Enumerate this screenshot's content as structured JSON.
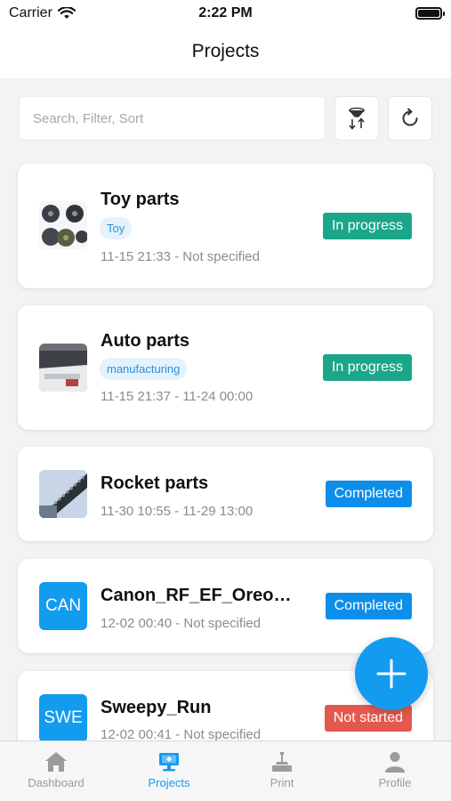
{
  "status_bar": {
    "carrier": "Carrier",
    "time": "2:22 PM"
  },
  "header": {
    "title": "Projects"
  },
  "search": {
    "placeholder": "Search, Filter, Sort"
  },
  "icons": {
    "filter": "filter-sort-icon",
    "refresh": "refresh-icon",
    "add": "plus-icon"
  },
  "projects": [
    {
      "title": "Toy parts",
      "tag": "Toy",
      "dates": "11-15 21:33 - Not specified",
      "status": "In progress",
      "status_color": "#1ba68a",
      "thumb": "image"
    },
    {
      "title": "Auto parts",
      "tag": "manufacturing",
      "dates": "11-15 21:37 - 11-24 00:00",
      "status": "In progress",
      "status_color": "#1ba68a",
      "thumb": "image"
    },
    {
      "title": "Rocket parts",
      "tag": "",
      "dates": "11-30 10:55 - 11-29 13:00",
      "status": "Completed",
      "status_color": "#0d8ee9",
      "thumb": "image"
    },
    {
      "title": "Canon_RF_EF_Oreo…",
      "tag": "",
      "dates": "12-02 00:40 - Not specified",
      "status": "Completed",
      "status_color": "#0d8ee9",
      "thumb_text": "CAN"
    },
    {
      "title": "Sweepy_Run",
      "tag": "",
      "dates": "12-02 00:41 - Not specified",
      "status": "Not started",
      "status_color": "#e4594e",
      "thumb_text": "SWE"
    }
  ],
  "tabs": [
    {
      "label": "Dashboard",
      "icon": "home-icon"
    },
    {
      "label": "Projects",
      "icon": "projects-icon",
      "active": true
    },
    {
      "label": "Print",
      "icon": "print-icon"
    },
    {
      "label": "Profile",
      "icon": "profile-icon"
    }
  ],
  "colors": {
    "accent": "#139bf0",
    "inactive": "#9b9b9b"
  }
}
